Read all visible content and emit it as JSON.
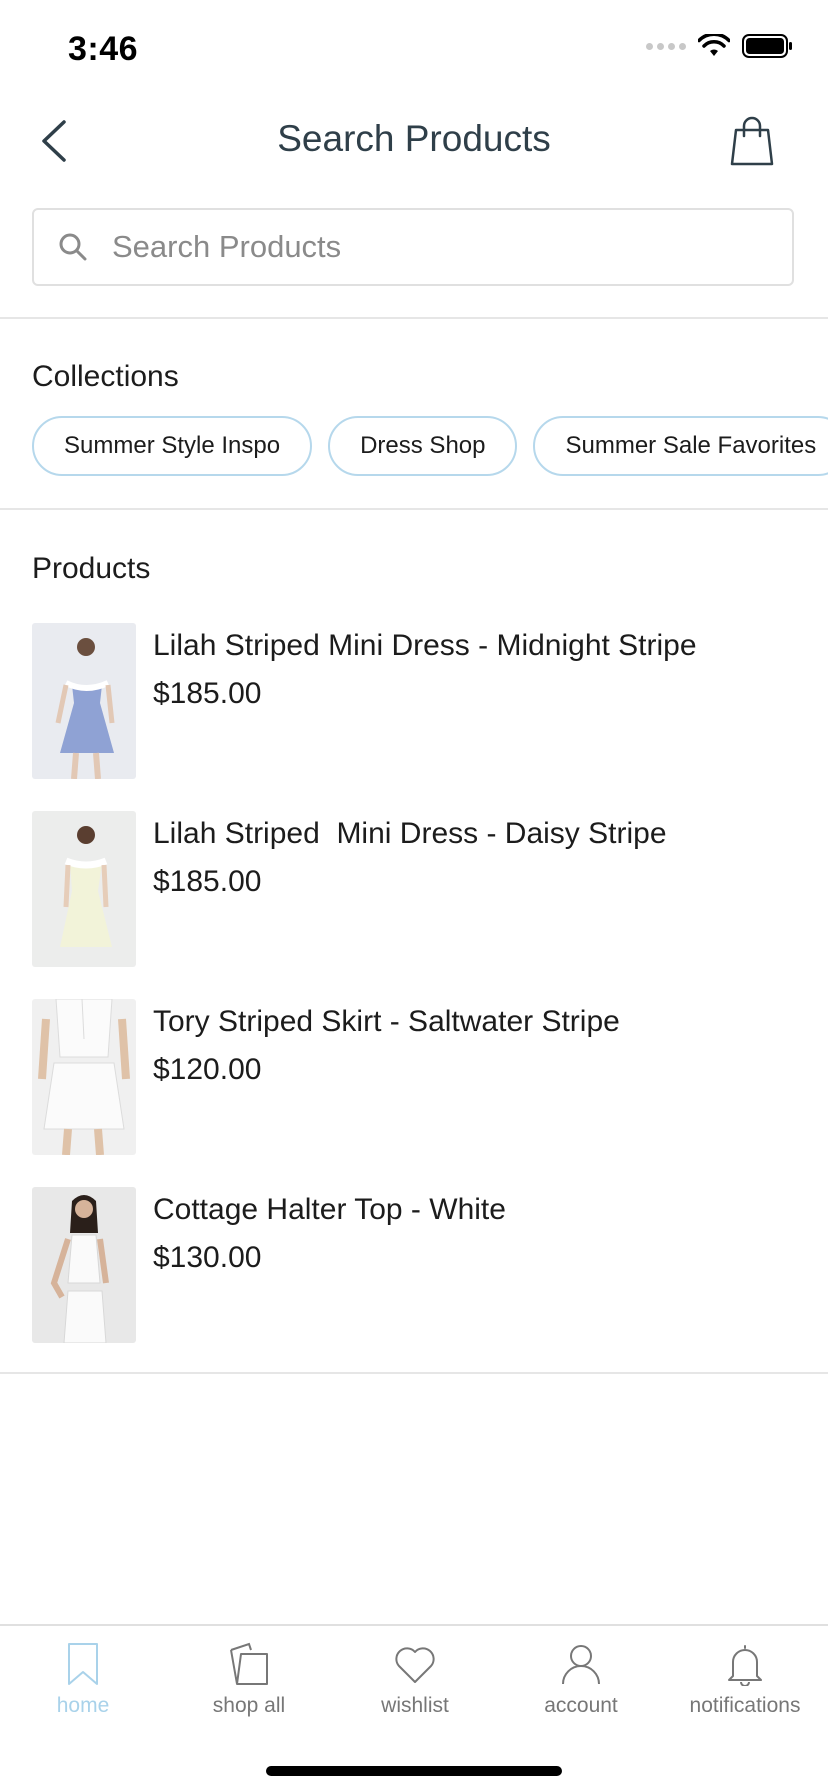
{
  "status_bar": {
    "time": "3:46"
  },
  "header": {
    "title": "Search Products"
  },
  "search": {
    "placeholder": "Search Products",
    "value": ""
  },
  "collections": {
    "title": "Collections",
    "items": [
      {
        "label": "Summer Style Inspo"
      },
      {
        "label": "Dress Shop"
      },
      {
        "label": "Summer Sale Favorites"
      }
    ]
  },
  "products": {
    "title": "Products",
    "items": [
      {
        "name": "Lilah Striped Mini Dress - Midnight Stripe",
        "price": "$185.00",
        "image_colors": [
          "#e9ebf0",
          "#8fa2d4"
        ]
      },
      {
        "name": "Lilah Striped  Mini Dress - Daisy Stripe",
        "price": "$185.00",
        "image_colors": [
          "#ecedec",
          "#f2f3d9"
        ]
      },
      {
        "name": "Tory Striped Skirt - Saltwater Stripe",
        "price": "$120.00",
        "image_colors": [
          "#f0f0f0",
          "#fbfbfb"
        ]
      },
      {
        "name": "Cottage Halter Top - White",
        "price": "$130.00",
        "image_colors": [
          "#e8e8e8",
          "#fafafa"
        ]
      }
    ]
  },
  "tab_bar": {
    "active_color": "#a9d2ea",
    "inactive_color": "#777777",
    "items": [
      {
        "label": "home",
        "icon": "bookmark-icon",
        "active": true
      },
      {
        "label": "shop all",
        "icon": "shopping-bag-icon",
        "active": false
      },
      {
        "label": "wishlist",
        "icon": "heart-icon",
        "active": false
      },
      {
        "label": "account",
        "icon": "person-icon",
        "active": false
      },
      {
        "label": "notifications",
        "icon": "bell-icon",
        "active": false
      }
    ]
  }
}
